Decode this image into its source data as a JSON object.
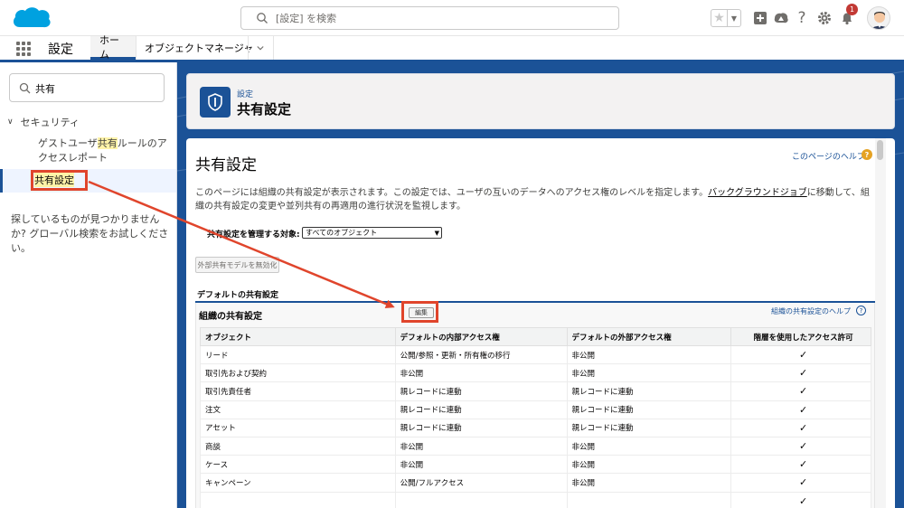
{
  "header": {
    "search_placeholder": "[設定] を検索",
    "notification_count": "1"
  },
  "app_nav": {
    "app_name": "設定",
    "tabs": [
      {
        "label": "ホーム"
      },
      {
        "label": "オブジェクトマネージャ"
      }
    ]
  },
  "sidebar": {
    "quick_find_value": "共有",
    "section": "セキュリティ",
    "item1_pre": "ゲストユーザ",
    "item1_hl": "共有",
    "item1_post": "ルールのアクセスレポート",
    "item2": "共有設定",
    "help_text": "探しているものが見つかりませんか? グローバル検索をお試しください。"
  },
  "page_header": {
    "breadcrumb": "設定",
    "title": "共有設定"
  },
  "content": {
    "title": "共有設定",
    "help_link": "このページのヘルプ",
    "desc_pre": "このページには組織の共有設定が表示されます。この設定では、ユーザの互いのデータへのアクセス権のレベルを指定します。",
    "desc_link": "バックグラウンドジョブ",
    "desc_post": "に移動して、組織の共有設定の変更や並列共有の再適用の進行状況を監視します。",
    "manage_label": "共有設定を管理する対象:",
    "manage_value": "すべてのオブジェクト",
    "disable_btn": "外部共有モデルを無効化",
    "default_label": "デフォルトの共有設定",
    "org_title": "組織の共有設定",
    "edit_btn": "編集",
    "org_help": "組織の共有設定のヘルプ"
  },
  "table": {
    "headers": [
      "オブジェクト",
      "デフォルトの内部アクセス権",
      "デフォルトの外部アクセス権",
      "階層を使用したアクセス許可"
    ],
    "rows": [
      [
        "リード",
        "公開/参照・更新・所有権の移行",
        "非公開",
        "✓"
      ],
      [
        "取引先および契約",
        "非公開",
        "非公開",
        "✓"
      ],
      [
        "取引先責任者",
        "親レコードに連動",
        "親レコードに連動",
        "✓"
      ],
      [
        "注文",
        "親レコードに連動",
        "親レコードに連動",
        "✓"
      ],
      [
        "アセット",
        "親レコードに連動",
        "親レコードに連動",
        "✓"
      ],
      [
        "商談",
        "非公開",
        "非公開",
        "✓"
      ],
      [
        "ケース",
        "非公開",
        "非公開",
        "✓"
      ],
      [
        "キャンペーン",
        "公開/フルアクセス",
        "非公開",
        "✓"
      ],
      [
        "",
        "",
        "",
        "✓"
      ]
    ]
  },
  "colors": {
    "brand_blue": "#1b5297",
    "callout_red": "#e0452c",
    "highlight_yellow": "#fff3a8"
  }
}
